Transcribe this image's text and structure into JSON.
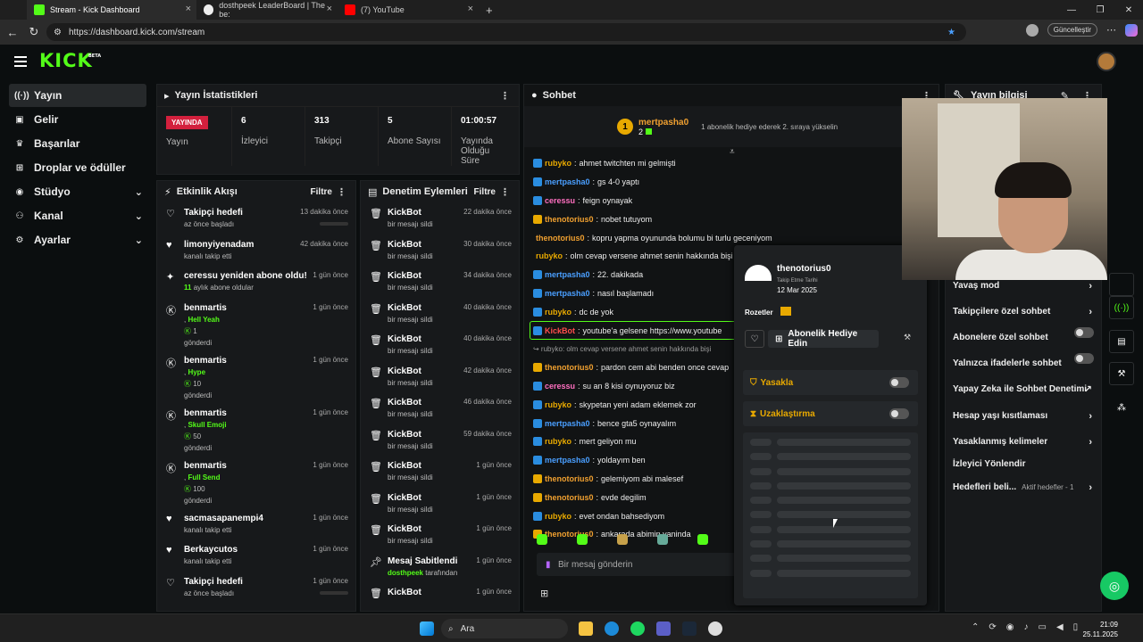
{
  "browser": {
    "tabs": [
      {
        "title": "Stream - Kick Dashboard",
        "active": true
      },
      {
        "title": "dosthpeek LeaderBoard | The be:",
        "active": false
      },
      {
        "title": "(7) YouTube",
        "active": false
      }
    ],
    "url": "https://dashboard.kick.com/stream",
    "update_button": "Güncelleştir"
  },
  "app": {
    "logo": "KICK",
    "logo_badge": "BETA"
  },
  "sidebar": {
    "items": [
      {
        "label": "Yayın",
        "icon": "broadcast-icon",
        "active": true
      },
      {
        "label": "Gelir",
        "icon": "revenue-icon"
      },
      {
        "label": "Başarılar",
        "icon": "trophy-icon"
      },
      {
        "label": "Droplar ve ödüller",
        "icon": "gift-icon"
      },
      {
        "label": "Stüdyo",
        "icon": "studio-icon",
        "chevron": true
      },
      {
        "label": "Kanal",
        "icon": "channel-icon",
        "chevron": true
      },
      {
        "label": "Ayarlar",
        "icon": "gear-icon",
        "chevron": true
      }
    ]
  },
  "stats": {
    "title": "Yayın İstatistikleri",
    "live_badge": "YAYINDA",
    "cells": [
      {
        "value": "",
        "label": "Yayın"
      },
      {
        "value": "6",
        "label": "İzleyici"
      },
      {
        "value": "313",
        "label": "Takipçi"
      },
      {
        "value": "5",
        "label": "Abone Sayısı"
      },
      {
        "value": "01:00:57",
        "label": "Yayında Olduğu Süre"
      }
    ]
  },
  "activity": {
    "title": "Etkinlik Akışı",
    "filter": "Filtre",
    "items": [
      {
        "icon": "heart-outline-icon",
        "name": "Takipçi hedefi",
        "sub": "az önce başladı",
        "time": "13 dakika önce",
        "bar": true
      },
      {
        "icon": "heart-icon",
        "name": "limonyiyenadam",
        "sub": "kanalı takip etti",
        "time": "42 dakika önce"
      },
      {
        "icon": "sparkle-icon",
        "name": "ceressu yeniden abone oldu!",
        "sub_hl": "11",
        "sub": "aylık abone oldular",
        "time": "1 gün önce"
      },
      {
        "icon": "kick-icon",
        "name": "benmartis",
        "gift": "Hell Yeah",
        "amount": "1",
        "sub": "gönderdi",
        "time": "1 gün önce",
        "big": true
      },
      {
        "icon": "kick-icon",
        "name": "benmartis",
        "gift": "Hype",
        "amount": "10",
        "sub": "gönderdi",
        "time": "1 gün önce",
        "big": true
      },
      {
        "icon": "kick-icon",
        "name": "benmartis",
        "gift": "Skull Emoji",
        "amount": "50",
        "sub": "gönderdi",
        "time": "1 gün önce",
        "big": true
      },
      {
        "icon": "kick-icon",
        "name": "benmartis",
        "gift": "Full Send",
        "amount": "100",
        "sub": "gönderdi",
        "time": "1 gün önce",
        "big": true
      },
      {
        "icon": "heart-icon",
        "name": "sacmasapanempi4",
        "sub": "kanalı takip etti",
        "time": "1 gün önce"
      },
      {
        "icon": "heart-icon",
        "name": "Berkaycutos",
        "sub": "kanalı takip etti",
        "time": "1 gün önce"
      },
      {
        "icon": "heart-outline-icon",
        "name": "Takipçi hedefi",
        "sub": "az önce başladı",
        "time": "1 gün önce",
        "bar": true
      }
    ]
  },
  "moderation": {
    "title": "Denetim Eylemleri",
    "filter": "Filtre",
    "items": [
      {
        "icon": "trash-icon",
        "name": "KickBot",
        "sub": "bir mesajı sildi",
        "time": "22 dakika önce"
      },
      {
        "icon": "trash-icon",
        "name": "KickBot",
        "sub": "bir mesajı sildi",
        "time": "30 dakika önce"
      },
      {
        "icon": "trash-icon",
        "name": "KickBot",
        "sub": "bir mesajı sildi",
        "time": "34 dakika önce"
      },
      {
        "icon": "trash-icon",
        "name": "KickBot",
        "sub": "bir mesajı sildi",
        "time": "40 dakika önce"
      },
      {
        "icon": "trash-icon",
        "name": "KickBot",
        "sub": "bir mesajı sildi",
        "time": "40 dakika önce"
      },
      {
        "icon": "trash-icon",
        "name": "KickBot",
        "sub": "bir mesajı sildi",
        "time": "42 dakika önce"
      },
      {
        "icon": "trash-icon",
        "name": "KickBot",
        "sub": "bir mesajı sildi",
        "time": "46 dakika önce"
      },
      {
        "icon": "trash-icon",
        "name": "KickBot",
        "sub": "bir mesajı sildi",
        "time": "59 dakika önce"
      },
      {
        "icon": "trash-icon",
        "name": "KickBot",
        "sub": "bir mesajı sildi",
        "time": "1 gün önce"
      },
      {
        "icon": "trash-icon",
        "name": "KickBot",
        "sub": "bir mesajı sildi",
        "time": "1 gün önce"
      },
      {
        "icon": "trash-icon",
        "name": "KickBot",
        "sub": "bir mesajı sildi",
        "time": "1 gün önce"
      },
      {
        "icon": "pin-icon",
        "name": "Mesaj Sabitlendi",
        "sub_hl": "dosthpeek",
        "sub": "tarafından",
        "time": "1 gün önce"
      },
      {
        "icon": "trash-icon",
        "name": "KickBot",
        "sub": "",
        "time": "1 gün önce"
      }
    ]
  },
  "chat": {
    "title": "Sohbet",
    "pinned": {
      "rank": "1",
      "user": "mertpasha0",
      "count": "2",
      "text": "1 abonelik hediye ederek 2. sıraya yükselin"
    },
    "messages": [
      {
        "user": "rubyko",
        "text": "ahmet twitchten mi gelmişti",
        "color": "#e8a900"
      },
      {
        "user": "mertpasha0",
        "text": "gs 4-0 yaptı",
        "color": "#4a9fff"
      },
      {
        "user": "ceressu",
        "text": "feign oynayak",
        "color": "#ff6fc0"
      },
      {
        "user": "thenotorius0",
        "text": "nobet tutuyom",
        "color": "#f0a030"
      },
      {
        "user": "thenotorius0",
        "text": "kopru yapma oyununda bolumu bi turlu geceniyom",
        "color": "#f0a030"
      },
      {
        "user": "rubyko",
        "text": "olm cevap versene ahmet senin hakkında bişi soruyo",
        "color": "#e8a900"
      },
      {
        "user": "mertpasha0",
        "text": "22. dakikada",
        "color": "#4a9fff"
      },
      {
        "user": "mertpasha0",
        "text": "nasıl başlamadı",
        "color": "#4a9fff"
      },
      {
        "user": "rubyko",
        "text": "dc de yok",
        "color": "#e8a900"
      },
      {
        "user": "KickBot",
        "text": "youtube'a gelsene https://www.youtube",
        "color": "#ff4d4d",
        "bot": true
      },
      {
        "user": "",
        "text": "↪ rubyko: olm cevap versene ahmet senin hakkında bişi",
        "color": "#999",
        "reply": true
      },
      {
        "user": "thenotorius0",
        "text": "pardon cem abi benden once cevap",
        "color": "#f0a030"
      },
      {
        "user": "ceressu",
        "text": "su an 8 kisi oynuyoruz biz",
        "color": "#ff6fc0"
      },
      {
        "user": "rubyko",
        "text": "skypetan yeni adam eklemek zor",
        "color": "#e8a900"
      },
      {
        "user": "mertpasha0",
        "text": "bence gta5 oynayalım",
        "color": "#4a9fff"
      },
      {
        "user": "rubyko",
        "text": "mert geliyon mu",
        "color": "#e8a900"
      },
      {
        "user": "mertpasha0",
        "text": "yoldayım ben",
        "color": "#4a9fff"
      },
      {
        "user": "thenotorius0",
        "text": "gelemiyom abi malesef",
        "color": "#f0a030"
      },
      {
        "user": "thenotorius0",
        "text": "evde degilim",
        "color": "#f0a030"
      },
      {
        "user": "rubyko",
        "text": "evet ondan bahsediyom",
        "color": "#e8a900"
      },
      {
        "user": "thenotorius0",
        "text": "ankarada abimin yaninda",
        "color": "#f0a030"
      }
    ],
    "input_placeholder": "Bir mesaj gönderin"
  },
  "user_card": {
    "name": "thenotorius0",
    "follow_since_label": "Takip Etme Tarihi",
    "follow_date": "12 Mar 2025",
    "badges_label": "Rozetler",
    "gift_button": "Abonelik Hediye Edin",
    "ban_label": "Yasakla",
    "timeout_label": "Uzaklaştırma"
  },
  "stream_info": {
    "title": "Yayın bilgisi",
    "rows": [
      {
        "label": "Yavaş mod",
        "type": "chevron"
      },
      {
        "label": "Takipçilere özel sohbet",
        "type": "chevron"
      },
      {
        "label": "Abonelere özel sohbet",
        "type": "toggle"
      },
      {
        "label": "Yalnızca ifadelerle sohbet",
        "type": "toggle"
      },
      {
        "label": "Yapay Zeka ile Sohbet Denetimi",
        "type": "external"
      },
      {
        "label": "Hesap yaşı kısıtlaması",
        "type": "chevron"
      },
      {
        "label": "Yasaklanmış kelimeler",
        "type": "chevron"
      },
      {
        "label": "İzleyici Yönlendir",
        "type": "none"
      },
      {
        "label": "Hedefleri beli...",
        "type": "chevron",
        "extra": "Aktif hedefler - 1"
      }
    ]
  },
  "taskbar": {
    "search": "Ara",
    "time": "21:09",
    "date": "25.11.2025"
  },
  "colors": {
    "accent": "#53fc18",
    "live": "#d3203d",
    "panel": "#17191b"
  }
}
